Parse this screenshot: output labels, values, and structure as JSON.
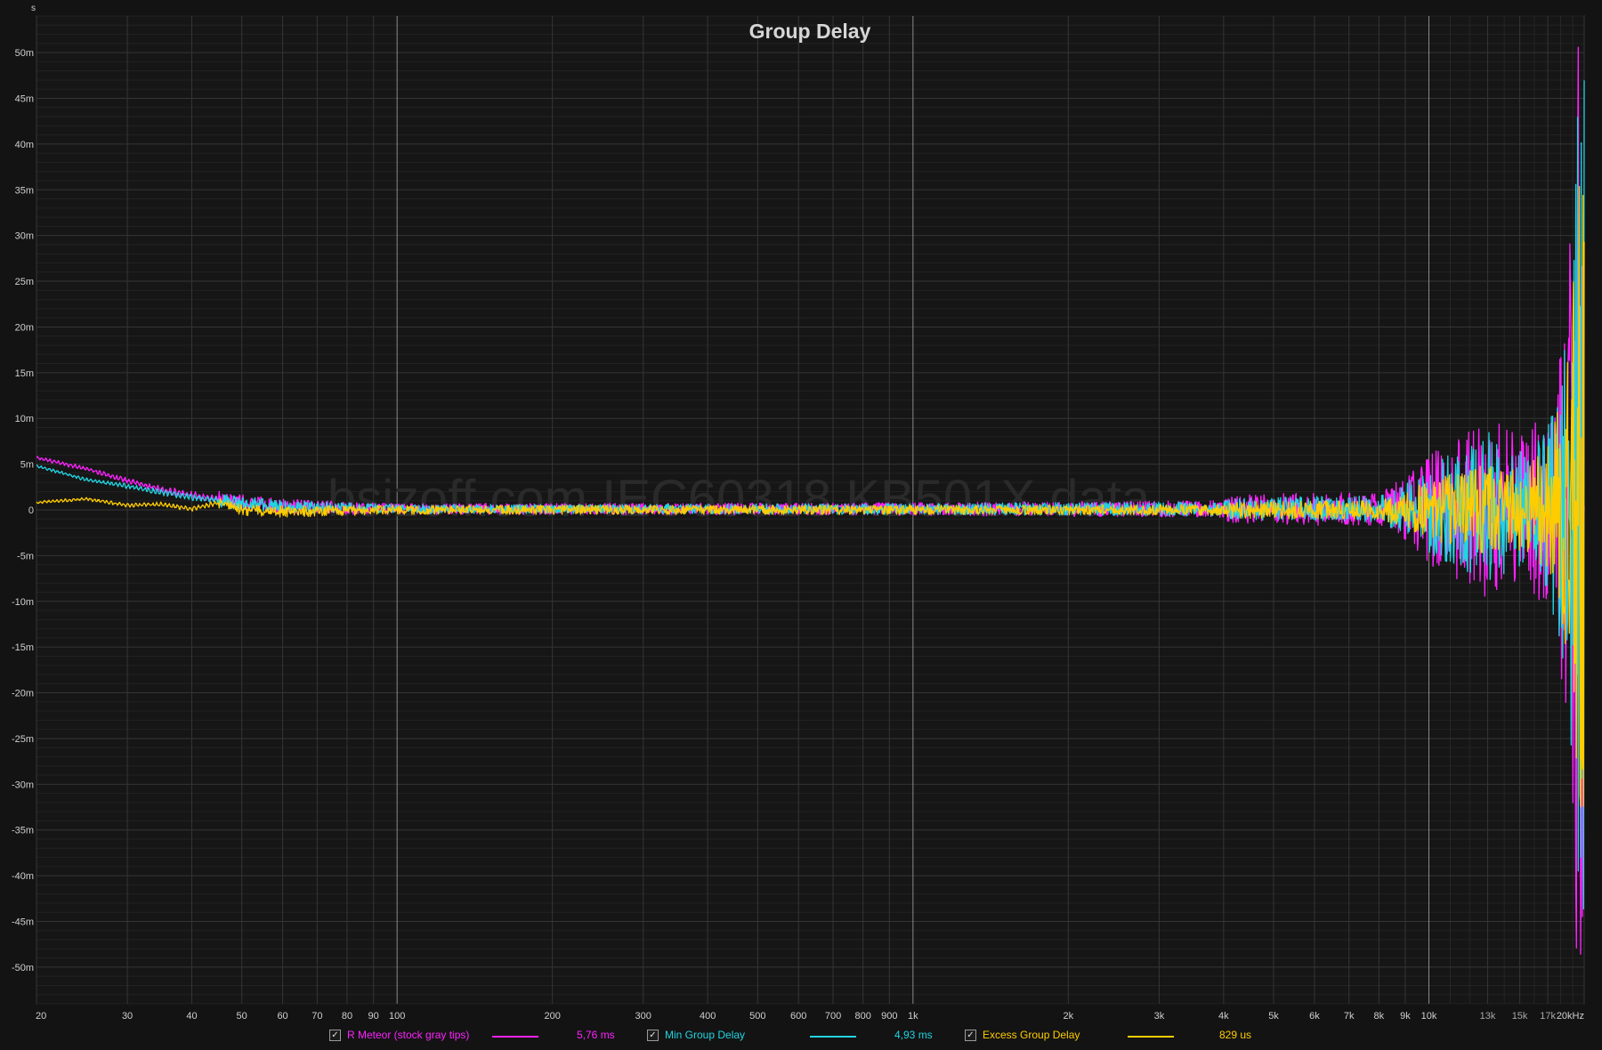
{
  "chart_data": {
    "type": "line",
    "title": "Group Delay",
    "y_unit_label": "s",
    "x_scale": "log",
    "xlim": [
      20,
      20000
    ],
    "ylim": [
      -0.054,
      0.054
    ],
    "grid": true,
    "legend_placement": "bottom",
    "watermark": "bsizoff.com IEC60318 KB501X data",
    "x_tick_labels": [
      {
        "v": 20,
        "t": "20"
      },
      {
        "v": 30,
        "t": "30"
      },
      {
        "v": 40,
        "t": "40"
      },
      {
        "v": 50,
        "t": "50"
      },
      {
        "v": 60,
        "t": "60"
      },
      {
        "v": 70,
        "t": "70"
      },
      {
        "v": 80,
        "t": "80"
      },
      {
        "v": 90,
        "t": "90"
      },
      {
        "v": 100,
        "t": "100"
      },
      {
        "v": 200,
        "t": "200"
      },
      {
        "v": 300,
        "t": "300"
      },
      {
        "v": 400,
        "t": "400"
      },
      {
        "v": 500,
        "t": "500"
      },
      {
        "v": 600,
        "t": "600"
      },
      {
        "v": 700,
        "t": "700"
      },
      {
        "v": 800,
        "t": "800"
      },
      {
        "v": 900,
        "t": "900"
      },
      {
        "v": 1000,
        "t": "1k"
      },
      {
        "v": 2000,
        "t": "2k"
      },
      {
        "v": 3000,
        "t": "3k"
      },
      {
        "v": 4000,
        "t": "4k"
      },
      {
        "v": 5000,
        "t": "5k"
      },
      {
        "v": 6000,
        "t": "6k"
      },
      {
        "v": 7000,
        "t": "7k"
      },
      {
        "v": 8000,
        "t": "8k"
      },
      {
        "v": 9000,
        "t": "9k"
      },
      {
        "v": 10000,
        "t": "10k"
      },
      {
        "v": 13000,
        "t": "13k"
      },
      {
        "v": 15000,
        "t": "15k"
      },
      {
        "v": 17000,
        "t": "17k"
      },
      {
        "v": 20000,
        "t": "20kHz"
      }
    ],
    "y_tick_labels": [
      {
        "v": 0.05,
        "t": "50m"
      },
      {
        "v": 0.045,
        "t": "45m"
      },
      {
        "v": 0.04,
        "t": "40m"
      },
      {
        "v": 0.035,
        "t": "35m"
      },
      {
        "v": 0.03,
        "t": "30m"
      },
      {
        "v": 0.025,
        "t": "25m"
      },
      {
        "v": 0.02,
        "t": "20m"
      },
      {
        "v": 0.015,
        "t": "15m"
      },
      {
        "v": 0.01,
        "t": "10m"
      },
      {
        "v": 0.005,
        "t": "5m"
      },
      {
        "v": 0,
        "t": "0"
      },
      {
        "v": -0.005,
        "t": "-5m"
      },
      {
        "v": -0.01,
        "t": "-10m"
      },
      {
        "v": -0.015,
        "t": "-15m"
      },
      {
        "v": -0.02,
        "t": "-20m"
      },
      {
        "v": -0.025,
        "t": "-25m"
      },
      {
        "v": -0.03,
        "t": "-30m"
      },
      {
        "v": -0.035,
        "t": "-35m"
      },
      {
        "v": -0.04,
        "t": "-40m"
      },
      {
        "v": -0.045,
        "t": "-45m"
      },
      {
        "v": -0.05,
        "t": "-50m"
      }
    ],
    "series": [
      {
        "name": "R Meteor (stock gray tips)",
        "color": "#ff22ff",
        "checked": true,
        "value_label": "5,76 ms",
        "center_x": [
          20,
          25,
          30,
          35,
          40,
          50,
          60,
          80,
          100
        ],
        "center_y": [
          0.0057,
          0.0045,
          0.0032,
          0.0022,
          0.0016,
          0.0008,
          0.0004,
          0.0002,
          0.0001
        ],
        "spread_x": [
          20,
          40,
          60,
          100,
          200,
          1000,
          4000,
          4100,
          6000,
          8000,
          9000,
          10000,
          12000,
          13000,
          14000,
          15000,
          16000,
          17000,
          18000,
          18800,
          19300,
          20000
        ],
        "spread_y": [
          0.0004,
          0.0009,
          0.0008,
          0.0006,
          0.0006,
          0.0007,
          0.0009,
          0.0015,
          0.0018,
          0.0018,
          0.0035,
          0.006,
          0.009,
          0.0105,
          0.009,
          0.008,
          0.0095,
          0.011,
          0.018,
          0.03,
          0.05,
          0.055
        ]
      },
      {
        "name": "Min Group Delay",
        "color": "#22d4e2",
        "checked": true,
        "value_label": "4,93 ms",
        "center_x": [
          20,
          25,
          30,
          35,
          40,
          50,
          60,
          80,
          100
        ],
        "center_y": [
          0.0048,
          0.0033,
          0.0026,
          0.0019,
          0.0014,
          0.0007,
          0.0004,
          0.0002,
          0.0001
        ],
        "spread_x": [
          20,
          40,
          60,
          100,
          200,
          1000,
          4000,
          4100,
          6000,
          8000,
          9000,
          10000,
          12000,
          13000,
          14000,
          15000,
          16000,
          17000,
          18000,
          18800,
          19300,
          20000
        ],
        "spread_y": [
          0.0003,
          0.0008,
          0.0007,
          0.0005,
          0.0005,
          0.0006,
          0.0008,
          0.0012,
          0.0014,
          0.0014,
          0.0028,
          0.0048,
          0.0072,
          0.0085,
          0.0072,
          0.0065,
          0.0075,
          0.009,
          0.015,
          0.026,
          0.045,
          0.053
        ]
      },
      {
        "name": "Excess Group Delay",
        "color": "#ffcc00",
        "checked": true,
        "value_label": "829 us",
        "center_x": [
          20,
          25,
          30,
          35,
          40,
          45,
          50,
          60,
          100
        ],
        "center_y": [
          0.0008,
          0.0012,
          0.0005,
          0.0006,
          0.0001,
          0.0008,
          0.0,
          -0.0002,
          0.0
        ],
        "spread_x": [
          20,
          40,
          60,
          100,
          200,
          1000,
          4000,
          4100,
          6000,
          8000,
          9000,
          10000,
          12000,
          13000,
          14000,
          15000,
          16000,
          17000,
          18000,
          18800,
          19300,
          20000
        ],
        "spread_y": [
          0.0003,
          0.0006,
          0.0006,
          0.0005,
          0.0005,
          0.0005,
          0.0006,
          0.0009,
          0.001,
          0.001,
          0.002,
          0.0032,
          0.0045,
          0.005,
          0.0045,
          0.0045,
          0.0055,
          0.007,
          0.012,
          0.022,
          0.035,
          0.04
        ]
      }
    ]
  }
}
